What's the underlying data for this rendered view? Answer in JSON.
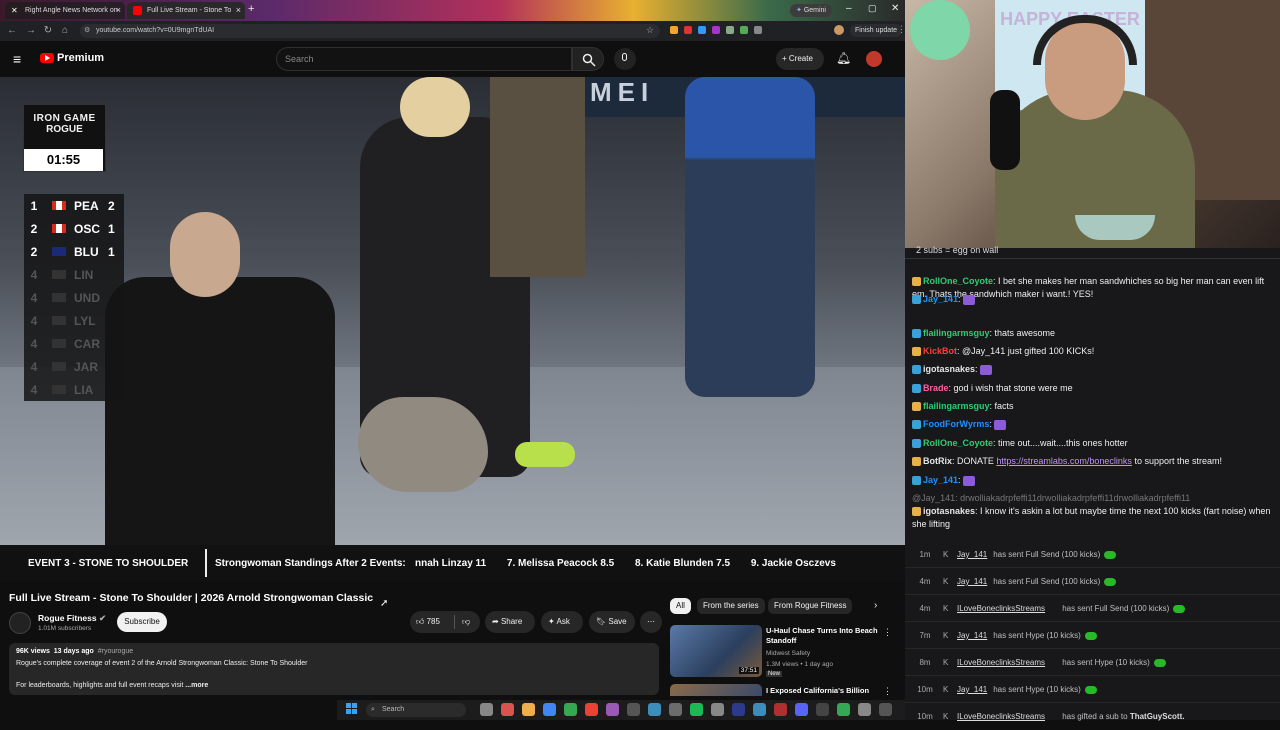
{
  "browser": {
    "tabs": [
      {
        "label": "Right Angle News Network on",
        "icon": "x-icon"
      },
      {
        "label": "Full Live Stream - Stone To",
        "icon": "youtube-icon"
      }
    ],
    "url": "youtube.com/watch?v=0U9mgnTdUAI",
    "gemini": "Gemini",
    "finish_update": "Finish update"
  },
  "youtube": {
    "logo": "Premium",
    "search_placeholder": "Search",
    "create": "Create"
  },
  "overlay": {
    "event_name_1": "IRON GAME",
    "event_name_2": "ROGUE",
    "timer": "01:55",
    "standings": [
      {
        "rank": "1",
        "code": "PEA",
        "score": "2",
        "flag": "canada",
        "active": true
      },
      {
        "rank": "2",
        "code": "OSC",
        "score": "1",
        "flag": "canada",
        "active": true
      },
      {
        "rank": "2",
        "code": "BLU",
        "score": "1",
        "flag": "australia",
        "active": true
      },
      {
        "rank": "4",
        "code": "LIN",
        "score": "",
        "flag": "usa",
        "active": false
      },
      {
        "rank": "4",
        "code": "UND",
        "score": "",
        "flag": "uk",
        "active": false
      },
      {
        "rank": "4",
        "code": "LYL",
        "score": "",
        "flag": "usa",
        "active": false
      },
      {
        "rank": "4",
        "code": "CAR",
        "score": "",
        "flag": "usa",
        "active": false
      },
      {
        "rank": "4",
        "code": "JAR",
        "score": "",
        "flag": "usa",
        "active": false
      },
      {
        "rank": "4",
        "code": "LIA",
        "score": "",
        "flag": "ukraine",
        "active": false
      }
    ],
    "banner_text": "MEI",
    "ticker_event": "EVENT 3 - STONE TO SHOULDER",
    "ticker_heading": "Strongwoman Standings After 2 Events:",
    "ticker_items": [
      "nnah Linzay 11",
      "7. Melissa Peacock 8.5",
      "8. Katie Blunden 7.5",
      "9. Jackie Osczevs"
    ]
  },
  "video_info": {
    "title": "Full Live Stream - Stone To Shoulder | 2026 Arnold Strongwoman Classic",
    "channel": "Rogue Fitness",
    "subscribers": "1.01M subscribers",
    "subscribe": "Subscribe",
    "likes": "785",
    "share": "Share",
    "ask": "Ask",
    "save": "Save",
    "meta": "96K views  13 days ago  #rogueroguegue",
    "meta_views": "96K views",
    "meta_date": "13 days ago",
    "meta_tag": "#ryourogue",
    "desc1": "Rogue's complete coverage of event 2 of the Arnold Strongwoman Classic: Stone To Shoulder",
    "desc2": "For leaderboards, highlights and full event recaps visit",
    "more": "...more"
  },
  "sidebar": {
    "chips": [
      "All",
      "From the series",
      "From Rogue Fitness"
    ],
    "videos": [
      {
        "title": "U-Haul Chase Turns Into Beach Standoff",
        "channel": "Midwest Safety",
        "meta": "1.3M views • 1 day ago",
        "badge": "New",
        "duration": "37:51"
      },
      {
        "title": "I Exposed California's Billion",
        "channel": "",
        "meta": "",
        "badge": "",
        "duration": ""
      }
    ]
  },
  "stream": {
    "webcam_banner": "HAPPY EASTER",
    "chat_header": "2 subs = egg on wall",
    "messages": [
      {
        "user": "RollOne_Coyote",
        "color": "#2ecc71",
        "text": "I bet she makes her man sandwhiches so big her man can even lift em. Thats the sandwhich maker i want.! YES!"
      },
      {
        "user": "Jay_141",
        "color": "#1e90ff",
        "text": ""
      },
      {
        "user": "flailingarmsguy",
        "color": "#2ecc71",
        "text": "thats awesome"
      },
      {
        "user": "KickBot",
        "color": "#ff3b3b",
        "text": "@Jay_141 just gifted 100 KICKs!"
      },
      {
        "user": "igotasnakes",
        "color": "#e6e6e6",
        "text": ""
      },
      {
        "user": "Brade",
        "color": "#ff5fa2",
        "text": "god i wish that stone were me"
      },
      {
        "user": "flailingarmsguy",
        "color": "#2ecc71",
        "text": "facts"
      },
      {
        "user": "FoodForWyrms",
        "color": "#1e90ff",
        "text": ""
      },
      {
        "user": "RollOne_Coyote",
        "color": "#2ecc71",
        "text": "time out....wait....this ones hotter"
      },
      {
        "user": "BotRix",
        "color": "#e6e6e6",
        "text": "DONATE",
        "link": "https://streamlabs.com/boneclinks",
        "after": "to support the stream!"
      },
      {
        "user": "Jay_141",
        "color": "#1e90ff",
        "text": ""
      },
      {
        "user": "",
        "color": "#777",
        "text": "@Jay_141: drwolliakadrpfeffi11drwolliakadrpfeffi11drwolliakadrpfeffi11"
      },
      {
        "user": "igotasnakes",
        "color": "#e6e6e6",
        "text": "I know it's askin a lot but maybe time the next 100 kicks (fart noise) when she lifting"
      }
    ],
    "events": [
      {
        "time": "1m",
        "user": "Jay_141",
        "text": "has sent Full Send (100 kicks)"
      },
      {
        "time": "4m",
        "user": "Jay_141",
        "text": "has sent Full Send (100 kicks)"
      },
      {
        "time": "4m",
        "user": "ILoveBoneclinksStreams",
        "text": "has sent Full Send (100 kicks)"
      },
      {
        "time": "7m",
        "user": "Jay_141",
        "text": "has sent Hype (10 kicks)"
      },
      {
        "time": "8m",
        "user": "ILoveBoneclinksStreams",
        "text": "has sent Hype (10 kicks)"
      },
      {
        "time": "10m",
        "user": "Jay_141",
        "text": "has sent Hype (10 kicks)"
      },
      {
        "time": "10m",
        "user": "ILoveBoneclinksStreams",
        "text": "has gifted a sub to",
        "target": "ThatGuyScott."
      }
    ]
  },
  "taskbar": {
    "search": "Search"
  }
}
